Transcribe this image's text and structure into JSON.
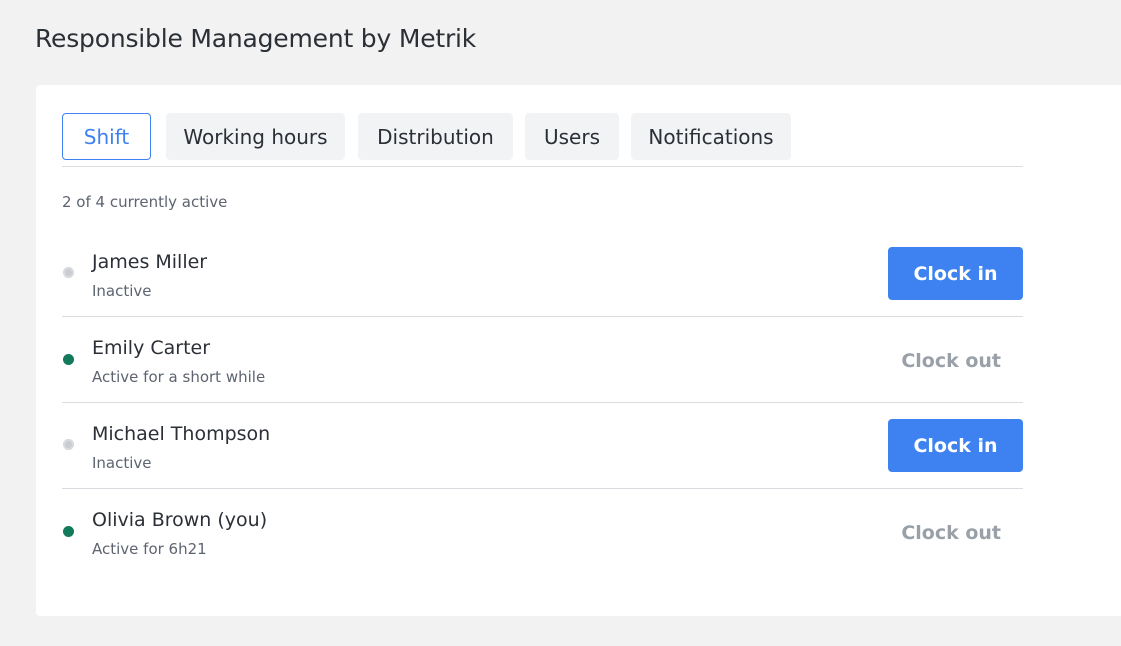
{
  "app": {
    "title": "Responsible Management by Metrik"
  },
  "tabs": [
    {
      "label": "Shift",
      "active": true
    },
    {
      "label": "Working hours",
      "active": false
    },
    {
      "label": "Distribution",
      "active": false
    },
    {
      "label": "Users",
      "active": false
    },
    {
      "label": "Notifications",
      "active": false
    }
  ],
  "summary": "2 of 4 currently active",
  "users": [
    {
      "name": "James Miller",
      "status": "Inactive",
      "state": "inactive",
      "action": "Clock in"
    },
    {
      "name": "Emily Carter",
      "status": "Active for a short while",
      "state": "active",
      "action": "Clock out"
    },
    {
      "name": "Michael Thompson",
      "status": "Inactive",
      "state": "inactive",
      "action": "Clock in"
    },
    {
      "name": "Olivia Brown (you)",
      "status": "Active for 6h21",
      "state": "active",
      "action": "Clock out"
    }
  ],
  "colors": {
    "accent": "#3d82f0",
    "active_dot": "#13795b",
    "inactive_dot": "#c9ccd0",
    "muted_action": "#9aa0a8"
  }
}
